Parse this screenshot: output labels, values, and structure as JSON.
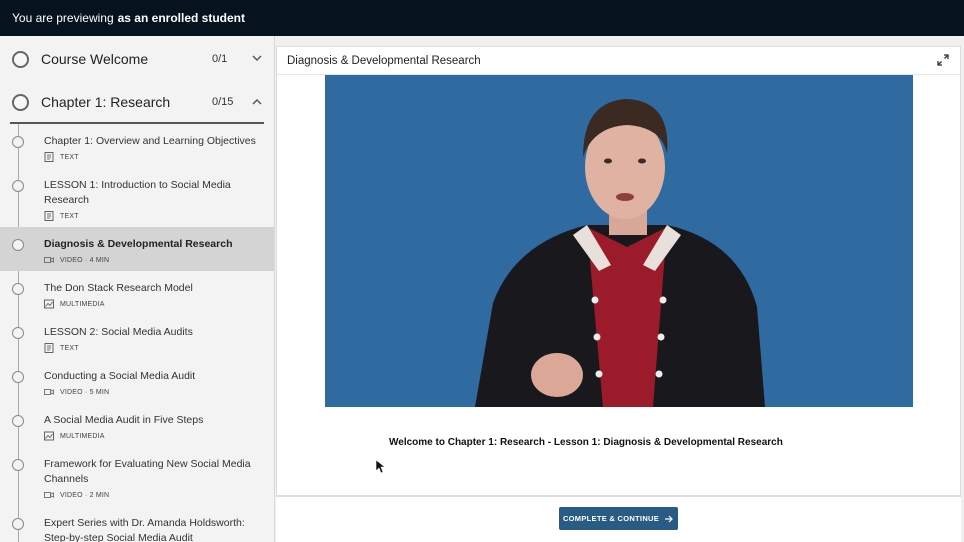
{
  "preview_bar": {
    "prefix": "You are previewing",
    "mode": "as an enrolled student"
  },
  "sidebar": {
    "sections": [
      {
        "title": "Course Welcome",
        "count": "0/1",
        "chevron": "chevron-down-icon"
      },
      {
        "title": "Chapter 1: Research",
        "count": "0/15",
        "chevron": "chevron-up-icon"
      }
    ],
    "lessons": [
      {
        "title": "Chapter 1: Overview and Learning Objectives",
        "type": "TEXT",
        "icon": "text-icon"
      },
      {
        "title": "LESSON 1: Introduction to Social Media Research",
        "type": "TEXT",
        "icon": "text-icon"
      },
      {
        "title": "Diagnosis & Developmental Research",
        "type": "VIDEO · 4 MIN",
        "icon": "video-icon"
      },
      {
        "title": "The Don Stack Research Model",
        "type": "MULTIMEDIA",
        "icon": "multimedia-icon"
      },
      {
        "title": "LESSON 2: Social Media Audits",
        "type": "TEXT",
        "icon": "text-icon"
      },
      {
        "title": "Conducting a Social Media Audit",
        "type": "VIDEO · 5 MIN",
        "icon": "video-icon"
      },
      {
        "title": "A Social Media Audit in Five Steps",
        "type": "MULTIMEDIA",
        "icon": "multimedia-icon"
      },
      {
        "title": "Framework for Evaluating New Social Media Channels",
        "type": "VIDEO · 2 MIN",
        "icon": "video-icon"
      },
      {
        "title": "Expert Series with Dr. Amanda Holdsworth: Step-by-step Social Media Audit",
        "type": "",
        "icon": ""
      }
    ]
  },
  "main": {
    "header_title": "Diagnosis & Developmental Research",
    "caption": "Welcome to Chapter 1: Research - Lesson 1: Diagnosis & Developmental Research",
    "complete_button": "COMPLETE & CONTINUE",
    "colors": {
      "video_bg": "#2f6aa0",
      "button": "#285c84",
      "topbar": "#06131f"
    }
  }
}
